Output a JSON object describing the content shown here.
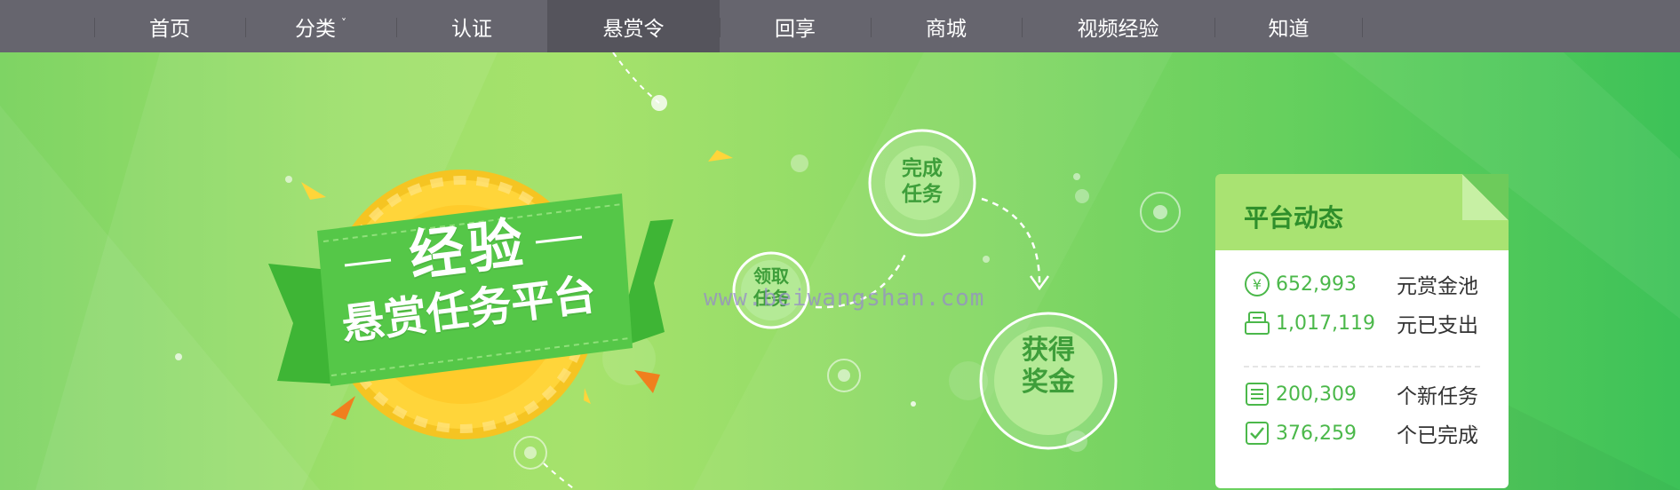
{
  "nav": {
    "items": [
      {
        "label": "首页",
        "has_caret": false,
        "active": false
      },
      {
        "label": "分类",
        "has_caret": true,
        "active": false
      },
      {
        "label": "认证",
        "has_caret": false,
        "active": false
      },
      {
        "label": "悬赏令",
        "has_caret": false,
        "active": true
      },
      {
        "label": "回享",
        "has_caret": false,
        "active": false
      },
      {
        "label": "商城",
        "has_caret": false,
        "active": false
      },
      {
        "label": "视频经验",
        "has_caret": false,
        "active": false
      },
      {
        "label": "知道",
        "has_caret": false,
        "active": false
      }
    ],
    "caret_glyph": "˅"
  },
  "banner": {
    "title_main": "经验",
    "title_sub": "悬赏任务平台",
    "steps": {
      "receive": [
        "领取",
        "任务"
      ],
      "complete": [
        "完成",
        "任务"
      ],
      "reward": [
        "获得",
        "奖金"
      ]
    },
    "watermark": "www.beiwangshan.com"
  },
  "panel": {
    "title": "平台动态",
    "stats": [
      {
        "icon": "yen-icon",
        "value": "652,993",
        "label": "元赏金池"
      },
      {
        "icon": "receipt-icon",
        "value": "1,017,119",
        "label": "元已支出"
      },
      {
        "icon": "document-icon",
        "value": "200,309",
        "label": "个新任务"
      },
      {
        "icon": "checkbox-icon",
        "value": "376,259",
        "label": "个已完成"
      }
    ]
  },
  "colors": {
    "nav_bg": "#66656e",
    "nav_active": "#55545c",
    "accent_green": "#4bb84a",
    "coin": "#ffd23b",
    "ribbon": "#4fc144"
  }
}
